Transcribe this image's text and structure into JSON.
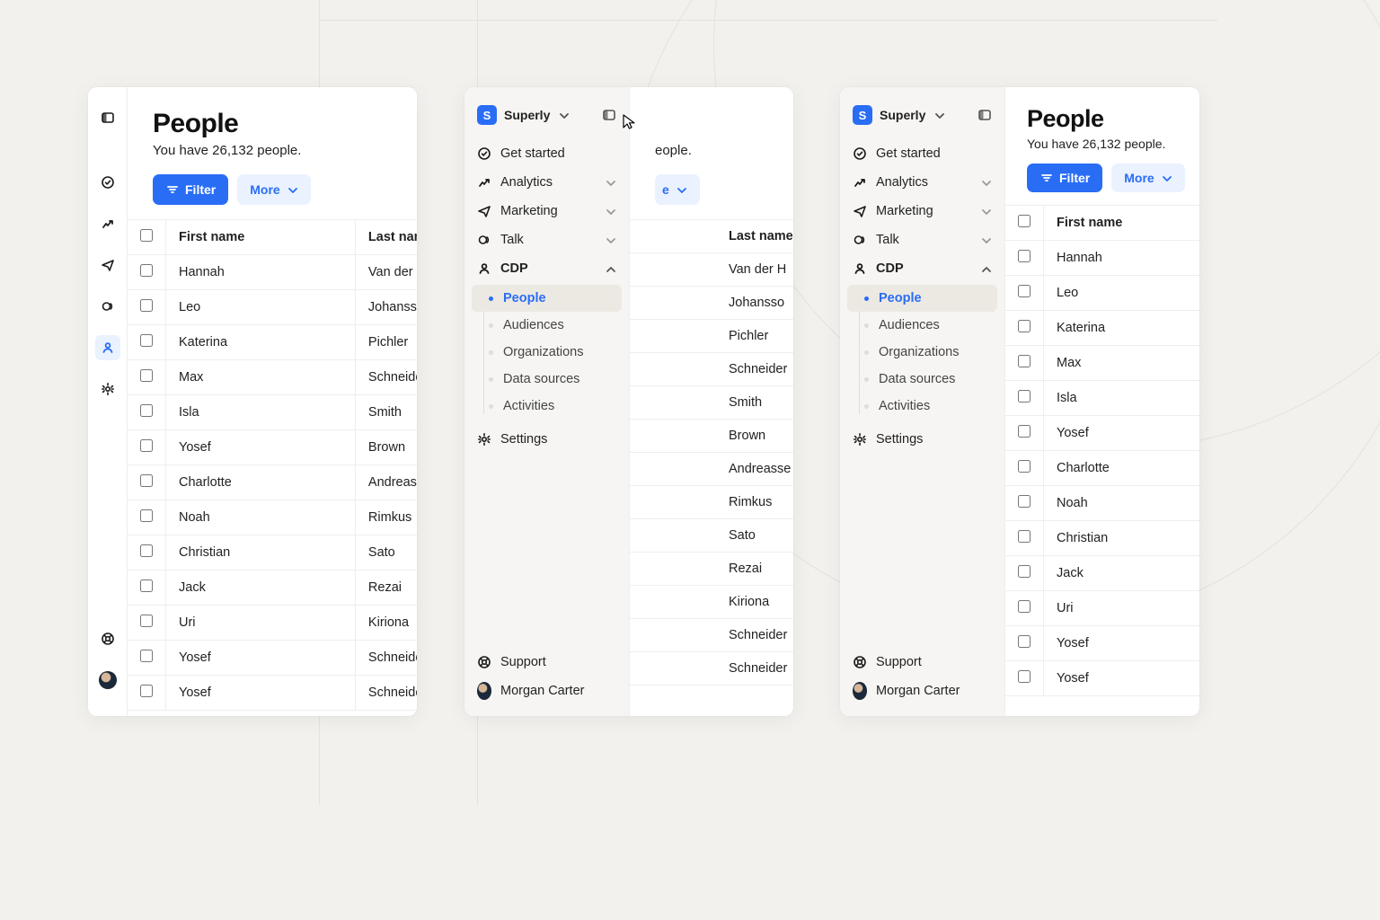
{
  "org": {
    "name": "Superly",
    "initial": "S"
  },
  "page": {
    "title": "People",
    "subtitle": "You have 26,132 people.",
    "filter_label": "Filter",
    "more_label": "More"
  },
  "nav": {
    "get_started": "Get started",
    "analytics": "Analytics",
    "marketing": "Marketing",
    "talk": "Talk",
    "cdp": "CDP",
    "settings": "Settings",
    "support": "Support",
    "user_name": "Morgan Carter",
    "cdp_children": {
      "people": "People",
      "audiences": "Audiences",
      "organizations": "Organizations",
      "data_sources": "Data sources",
      "activities": "Activities"
    }
  },
  "table": {
    "col_first": "First name",
    "col_last": "Last name"
  },
  "people": [
    {
      "first": "Hannah",
      "last": "Van der H"
    },
    {
      "first": "Leo",
      "last": "Johansso"
    },
    {
      "first": "Katerina",
      "last": "Pichler"
    },
    {
      "first": "Max",
      "last": "Schneider"
    },
    {
      "first": "Isla",
      "last": "Smith"
    },
    {
      "first": "Yosef",
      "last": "Brown"
    },
    {
      "first": "Charlotte",
      "last": "Andreasse"
    },
    {
      "first": "Noah",
      "last": "Rimkus"
    },
    {
      "first": "Christian",
      "last": "Sato"
    },
    {
      "first": "Jack",
      "last": "Rezai"
    },
    {
      "first": "Uri",
      "last": "Kiriona"
    },
    {
      "first": "Yosef",
      "last": "Schneider"
    },
    {
      "first": "Yosef",
      "last": "Schneider"
    }
  ],
  "panel2_last": [
    "Van der H",
    "Johansso",
    "Pichler",
    "Schneider",
    "Smith",
    "Brown",
    "Andreasse",
    "Rimkus",
    "Sato",
    "Rezai",
    "Kiriona",
    "Schneider",
    "Schneider"
  ]
}
